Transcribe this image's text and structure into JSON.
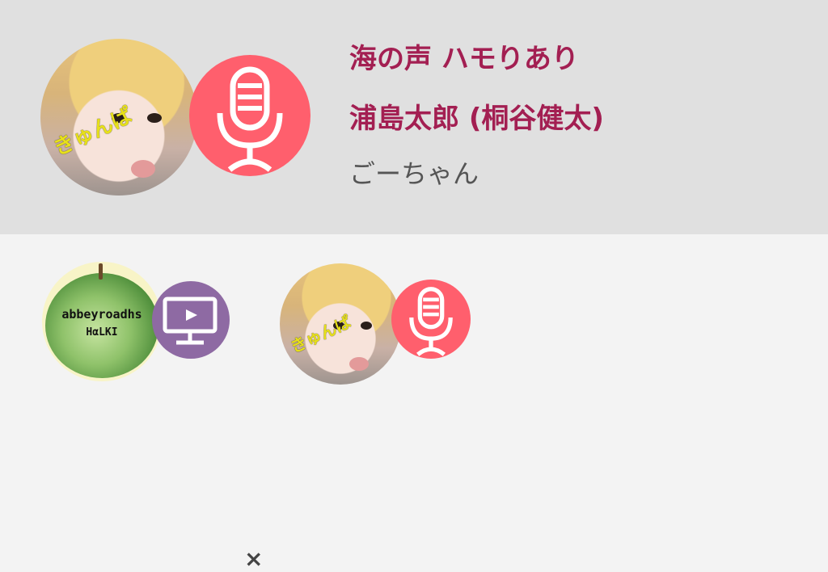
{
  "song": {
    "title": "海の声 ハモりあり",
    "original_artist": "浦島太郎 (桐谷健太)",
    "singer": "ごーちゃん"
  },
  "avatars": {
    "singer_scribble": "きゅんぱ",
    "partner_text_line1": "abbeyroadhs",
    "partner_text_line2": "HαLKI"
  },
  "icons": {
    "singer_role": "microphone-icon",
    "partner_role": "video-monitor-icon",
    "collab": "times-icon"
  },
  "collab": {
    "separator": "×"
  },
  "colors": {
    "title": "#a31f52",
    "mic_badge": "#ff5f6d",
    "video_badge": "#8e6aa3",
    "top_bg": "#e0e0e0",
    "bottom_bg": "#f3f3f3"
  }
}
